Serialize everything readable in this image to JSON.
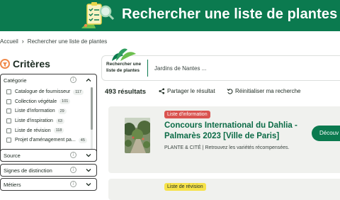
{
  "header": {
    "title": "Rechercher une liste de plantes",
    "logo_icon": "checklist-magnifier-icon",
    "background_color": "#0b7a4f"
  },
  "breadcrumb": {
    "home": "Accueil",
    "separator": "›",
    "current": "Rechercher une liste de plantes"
  },
  "sidebar": {
    "title": "Critères",
    "title_icon": "filter-icon",
    "panels": [
      {
        "label": "Catégorie",
        "expanded": true,
        "items": [
          {
            "label": "Catalogue de fournisseur",
            "count": "117"
          },
          {
            "label": "Collection végétale",
            "count": "101"
          },
          {
            "label": "Liste d'information",
            "count": "29"
          },
          {
            "label": "Liste d'inspiration",
            "count": "63"
          },
          {
            "label": "Liste de révision",
            "count": "118"
          },
          {
            "label": "Projet d'aménagement pa...",
            "count": "45"
          }
        ]
      },
      {
        "label": "Source",
        "expanded": false
      },
      {
        "label": "Signes de distinction",
        "expanded": false
      },
      {
        "label": "Métiers",
        "expanded": false
      }
    ]
  },
  "search": {
    "label": "Rechercher une liste de plantes",
    "placeholder": "Jardins de Nantes ..."
  },
  "results": {
    "count_text": "493 résultats",
    "share_label": "Partager le résultat",
    "reset_label": "Réinitialiser ma recherche"
  },
  "cards": [
    {
      "tag": "Liste d'information",
      "tag_color": "#d9534f",
      "title": "Concours International du Dahlia - Palmarès 2023 [Ville de Paris]",
      "description": "PLANTE & CITÉ | Retrouvez les variétés récompensées.",
      "button": "Découv"
    },
    {
      "tag": "Liste de révision",
      "tag_color": "#f6e24a"
    }
  ],
  "colors": {
    "accent": "#0b7a4f",
    "title_green": "#0b6b46",
    "card_bg": "#f0f1ee"
  }
}
